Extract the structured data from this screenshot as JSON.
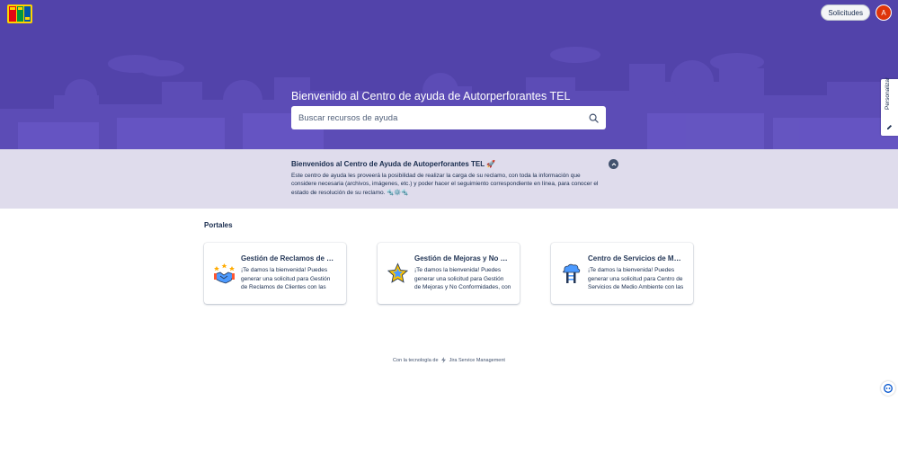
{
  "header": {
    "requests_label": "Solicitudes",
    "avatar_initial": "A"
  },
  "hero": {
    "title": "Bienvenido al Centro de ayuda de Autorperforantes TEL",
    "search_placeholder": "Buscar recursos de ayuda"
  },
  "side_tab": {
    "label": "Personalizar"
  },
  "announcement": {
    "title": "Bienvenidos al Centro de Ayuda de Autoperforantes TEL 🚀",
    "body": "Este centro de ayuda les proveerá la posibilidad de realizar la carga de su reclamo, con toda la información que considere necesaria (archivos, imágenes, etc.) y poder hacer el seguimiento correspondiente en línea, para conocer el estado de resolución de su reclamo. 🔩⚙️🔩"
  },
  "portals": {
    "heading": "Portales",
    "items": [
      {
        "title": "Gestión de Reclamos de Clientes",
        "description": "¡Te damos la bienvenida! Puedes generar una solicitud para Gestión de Reclamos de Clientes con las opciones que se ofrecen.",
        "icon": "handshake-stars-icon"
      },
      {
        "title": "Gestión de Mejoras y No Conformidades",
        "description": "¡Te damos la bienvenida! Puedes generar una solicitud para Gestión de Mejoras y No Conformidades, con las opciones que se ofrecen.",
        "icon": "star-badge-icon"
      },
      {
        "title": "Centro de Servicios de Medio Ambiente",
        "description": "¡Te damos la bienvenida! Puedes generar una solicitud para Centro de Servicios de Medio Ambiente con las opciones que se ofrecen.",
        "icon": "tree-cloud-icon"
      }
    ]
  },
  "footer": {
    "prefix": "Con la tecnología de",
    "product": "Jira Service Management"
  },
  "colors": {
    "hero_bg": "#5243aa",
    "announcement_bg": "#dfdcec",
    "avatar_bg": "#de350b"
  }
}
